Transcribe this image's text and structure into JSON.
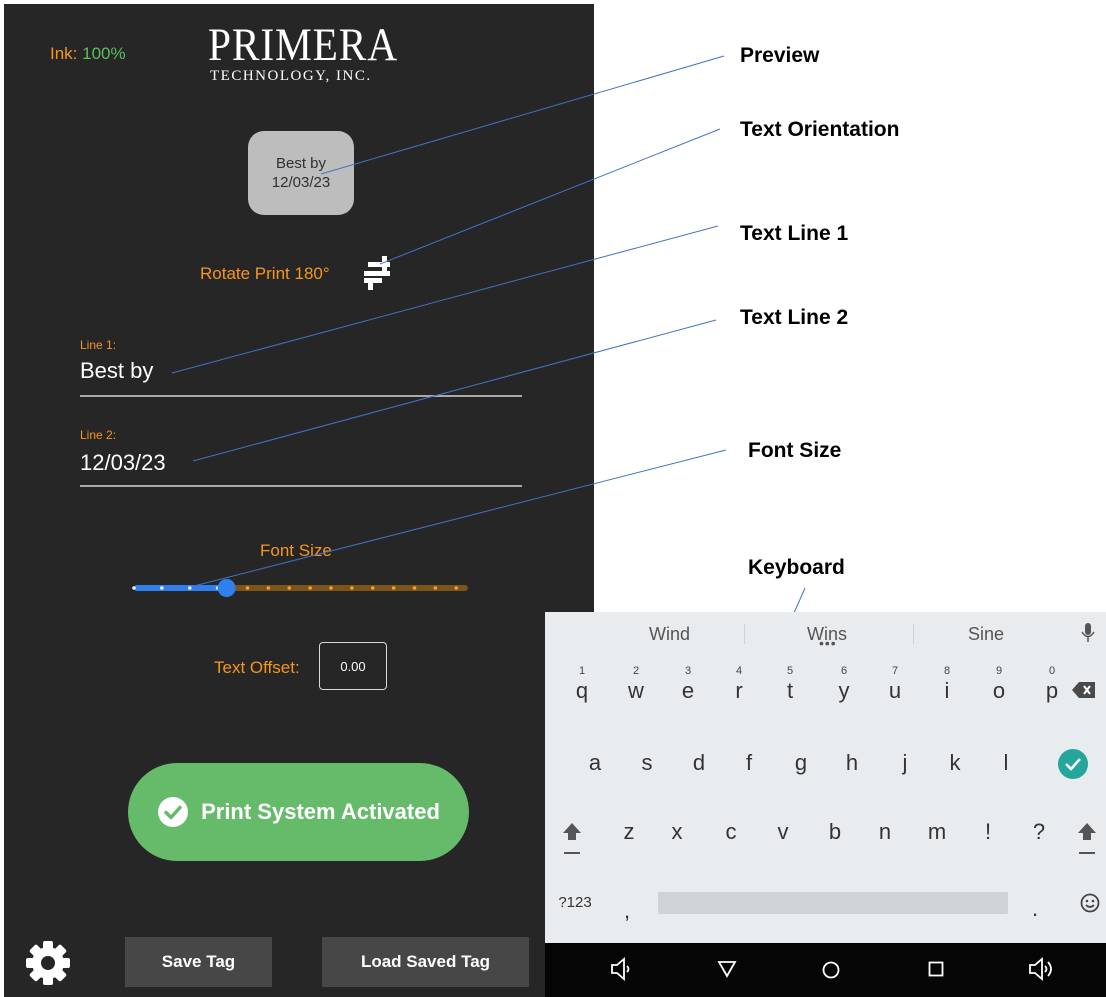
{
  "app": {
    "ink_label": "Ink:",
    "ink_value": "100%",
    "logo_main": "PRIMERA",
    "logo_sub": "TECHNOLOGY, INC.",
    "preview_line1": "Best by",
    "preview_line2": "12/03/23",
    "rotate_label": "Rotate Print 180°",
    "line1_label": "Line 1:",
    "line1_value": "Best by",
    "line2_label": "Line 2:",
    "line2_value": "12/03/23",
    "font_size_label": "Font Size",
    "font_size_slider": {
      "steps": 17,
      "selected_index": 3
    },
    "text_offset_label": "Text Offset:",
    "text_offset_value": "0.00",
    "print_button": "Print System Activated",
    "save_button": "Save Tag",
    "load_button": "Load Saved Tag",
    "colors": {
      "accent": "#f7961d",
      "ink_value": "#5bbf59",
      "print_button": "#66bb6a",
      "slider_active": "#2f80ed",
      "background": "#262626"
    }
  },
  "annotations": {
    "preview": "Preview",
    "text_orientation": "Text Orientation",
    "text_line_1": "Text Line 1",
    "text_line_2": "Text Line 2",
    "font_size": "Font Size",
    "keyboard": "Keyboard"
  },
  "keyboard": {
    "suggestions": [
      "Wind",
      "Wins",
      "Sine"
    ],
    "row1": [
      "q",
      "w",
      "e",
      "r",
      "t",
      "y",
      "u",
      "i",
      "o",
      "p"
    ],
    "row1_hints": [
      "1",
      "2",
      "3",
      "4",
      "5",
      "6",
      "7",
      "8",
      "9",
      "0"
    ],
    "row2": [
      "a",
      "s",
      "d",
      "f",
      "g",
      "h",
      "j",
      "k",
      "l"
    ],
    "row3": [
      "z",
      "x",
      "c",
      "v",
      "b",
      "n",
      "m",
      "!",
      "?"
    ],
    "symbols_key": "?123",
    "comma_key": ",",
    "period_key": ".",
    "icons": [
      "mic-icon",
      "backspace-icon",
      "done-check-icon",
      "shift-icon",
      "emoji-icon",
      "nav-back-icon",
      "nav-home-icon",
      "nav-recents-icon",
      "volume-icon"
    ]
  }
}
